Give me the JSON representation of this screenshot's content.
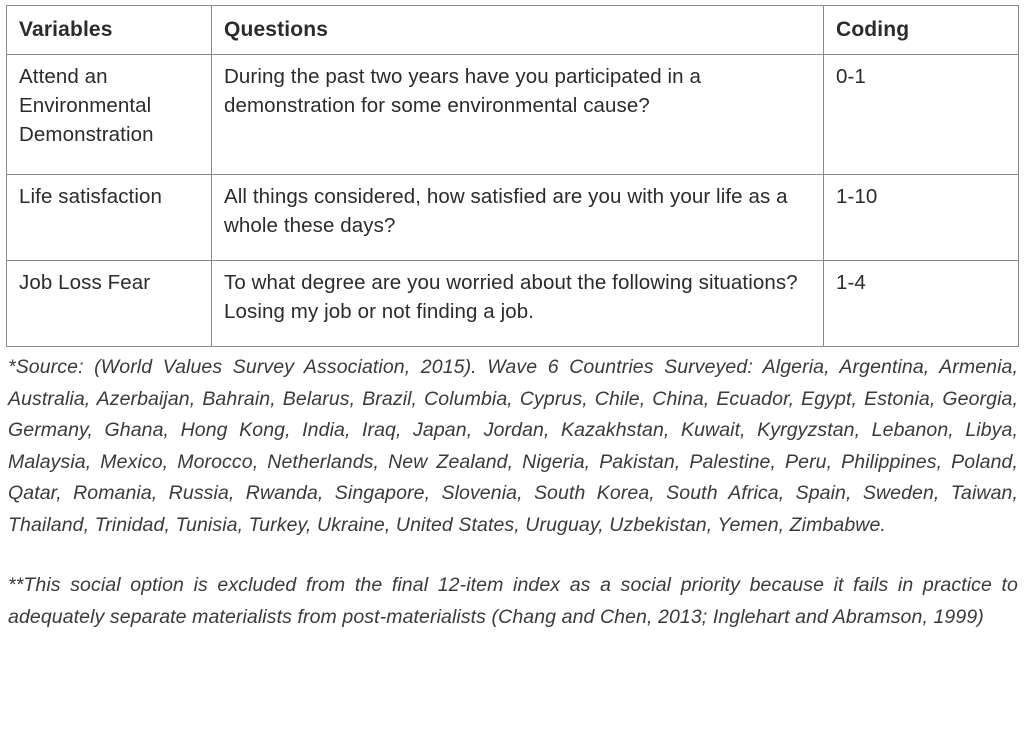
{
  "table": {
    "headers": [
      "Variables",
      "Questions",
      "Coding"
    ],
    "rows": [
      {
        "variable": "Attend an Environmental Demonstration",
        "question": "During the past two years have you participated in a demonstration for some environmental cause?",
        "coding": "0-1"
      },
      {
        "variable": "Life satisfaction",
        "question": "All things considered, how satisfied are you with your life as a whole these days?",
        "coding": "1-10"
      },
      {
        "variable": "Job Loss Fear",
        "question": "To what degree are you worried about the following situations? Losing my job or not finding a job.",
        "coding": "1-4"
      }
    ]
  },
  "notes": {
    "source_note": "*Source: (World Values Survey Association, 2015). Wave 6 Countries Surveyed: Algeria, Argentina, Armenia, Australia, Azerbaijan, Bahrain, Belarus, Brazil, Columbia, Cyprus, Chile, China, Ecuador, Egypt, Estonia, Georgia, Germany, Ghana, Hong Kong, India, Iraq, Japan, Jordan, Kazakhstan, Kuwait, Kyrgyzstan, Lebanon, Libya, Malaysia, Mexico, Morocco, Netherlands, New Zealand, Nigeria, Pakistan, Palestine, Peru, Philippines, Poland, Qatar, Romania, Russia, Rwanda, Singapore, Slovenia, South Korea, South Africa, Spain, Sweden, Taiwan, Thailand, Trinidad, Tunisia, Turkey, Ukraine, United States, Uruguay, Uzbekistan, Yemen, Zimbabwe.",
    "exclusion_note": "**This social option is excluded from the final 12-item index as a social priority because it fails in practice to adequately separate materialists from post-materialists (Chang and Chen, 2013; Inglehart and Abramson, 1999)"
  },
  "style": {
    "border_color": "#8a8a8a",
    "text_color": "#2b2b2b",
    "note_color": "#3a3a3a",
    "background": "#ffffff"
  }
}
